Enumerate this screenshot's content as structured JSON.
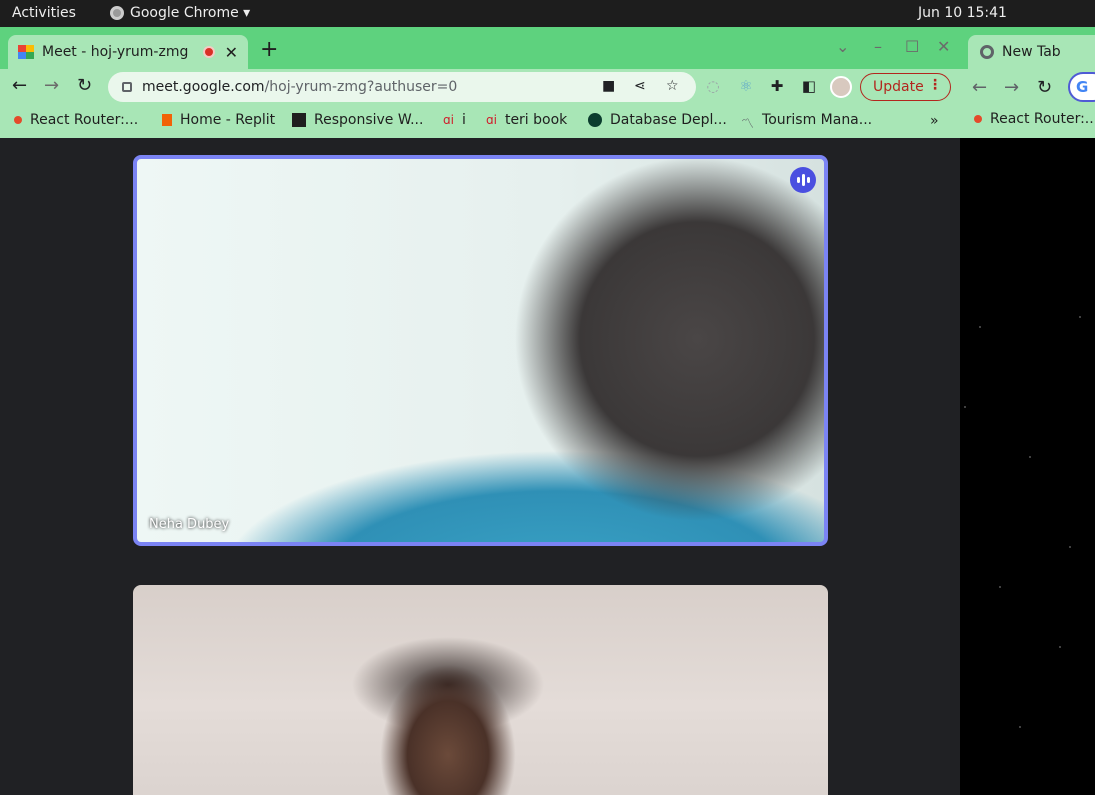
{
  "topbar": {
    "activities": "Activities",
    "app_name": "Google Chrome ▾",
    "clock": "Jun 10  15:41"
  },
  "main_window": {
    "tab": {
      "title": "Meet - hoj-yrum-zmg",
      "close": "✕"
    },
    "new_tab_symbol": "+",
    "window_controls": {
      "chevron": "⌄",
      "minimize": "–",
      "maximize": "☐",
      "close": "✕"
    },
    "url_host": "meet.google.com",
    "url_path": "/hoj-yrum-zmg?authuser=0",
    "update_label": "Update",
    "bookmarks": [
      {
        "label": "React Router:...",
        "color": "#e44a2a"
      },
      {
        "label": "Home - Replit",
        "color": "#f26207"
      },
      {
        "label": "Responsive W...",
        "color": "#1f1f1f"
      },
      {
        "label": "i",
        "color": "#d01b2a"
      },
      {
        "label": "teri book",
        "color": "#d01b2a"
      },
      {
        "label": "Database Depl...",
        "color": "#0b3d2e"
      },
      {
        "label": "Tourism Mana...",
        "color": "#5f6368"
      }
    ],
    "bookmarks_more": "»",
    "participants": [
      {
        "name": "Neha Dubey",
        "speaking": true
      },
      {
        "name": "",
        "speaking": false
      }
    ]
  },
  "second_window": {
    "tab_title": "New Tab",
    "bookmark": "React Router:..."
  },
  "colors": {
    "tab_strip": "#5ed27e",
    "toolbar": "#a8e6b6",
    "active_speaker_border": "#7b84f4",
    "update_red": "#b3261e"
  }
}
